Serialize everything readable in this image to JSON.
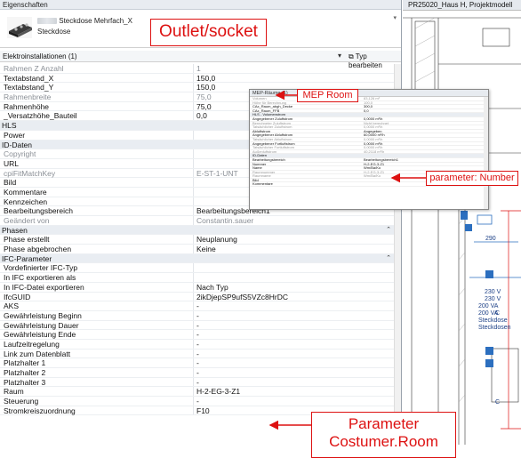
{
  "palette_title": "Eigenschaften",
  "type_selector": {
    "family": "Steckdose Mehrfach_X",
    "type": "Steckdose"
  },
  "filter": {
    "label": "Elektroinstallationen (1)",
    "edit_type": "Typ bearbeiten"
  },
  "rows": [
    {
      "k": "Rahmen Z Anzahl",
      "v": "1",
      "dim": true
    },
    {
      "k": "Textabstand_X",
      "v": "150,0"
    },
    {
      "k": "Textabstand_Y",
      "v": "150,0"
    },
    {
      "k": "Rahmenbreite",
      "v": "75,0",
      "dim": true
    },
    {
      "k": "Rahmenhöhe",
      "v": "75,0"
    },
    {
      "k": "_Versatzhöhe_Bauteil",
      "v": "0,0"
    },
    {
      "k": "HLS",
      "group": true
    },
    {
      "k": "Power",
      "v": ""
    },
    {
      "k": "ID-Daten",
      "group": true
    },
    {
      "k": "Copyright",
      "v": "",
      "dim": true
    },
    {
      "k": "URL",
      "v": ""
    },
    {
      "k": "cpiFitMatchKey",
      "v": "E-ST-1-UNT",
      "dim": true
    },
    {
      "k": "Bild",
      "v": ""
    },
    {
      "k": "Kommentare",
      "v": ""
    },
    {
      "k": "Kennzeichen",
      "v": ""
    },
    {
      "k": "Bearbeitungsbereich",
      "v": "Bearbeitungsbereich1"
    },
    {
      "k": "Geändert von",
      "v": "Constantin.sauer",
      "dim": true
    },
    {
      "k": "Phasen",
      "group": true,
      "chev": "⌃"
    },
    {
      "k": "Phase erstellt",
      "v": "Neuplanung"
    },
    {
      "k": "Phase abgebrochen",
      "v": "Keine"
    },
    {
      "k": "IFC-Parameter",
      "group": true,
      "chev": "⌃"
    },
    {
      "k": "Vordefinierter IFC-Typ",
      "v": ""
    },
    {
      "k": "In IFC exportieren als",
      "v": ""
    },
    {
      "k": "In IFC-Datei exportieren",
      "v": "Nach Typ"
    },
    {
      "k": "IfcGUID",
      "v": "2ikDjepSP9ufS5VZc8HrDC"
    },
    {
      "k": "AKS",
      "v": "-"
    },
    {
      "k": "Gewährleistung Beginn",
      "v": "-"
    },
    {
      "k": "Gewährleistung Dauer",
      "v": "-"
    },
    {
      "k": "Gewährleistung Ende",
      "v": "-"
    },
    {
      "k": "Laufzeitregelung",
      "v": "-"
    },
    {
      "k": "Link zum Datenblatt",
      "v": "-"
    },
    {
      "k": "Platzhalter 1",
      "v": "-"
    },
    {
      "k": "Platzhalter 2",
      "v": "-"
    },
    {
      "k": "Platzhalter 3",
      "v": "-"
    },
    {
      "k": "Raum",
      "v": "H-2-EG-3-Z1"
    },
    {
      "k": "Steuerung",
      "v": "-"
    },
    {
      "k": "Stromkreiszuordnung",
      "v": "F10"
    }
  ],
  "view": {
    "tab": "PR25020_Haus H, Projektmodell"
  },
  "mep": {
    "title": "MEP-Räume (1)",
    "rows": [
      {
        "k": "Volumen",
        "v": "83,126 m³",
        "dim": true
      },
      {
        "k": "Höhe für Berechnung",
        "v": "100,0",
        "dim": true
      },
      {
        "k": "CAx_Raum_abgh_Decke",
        "v": "300,0"
      },
      {
        "k": "CAx_Raum_FFB",
        "v": "0,0"
      },
      {
        "k": "HLS - Volumenstrom",
        "v": "",
        "g": true
      },
      {
        "k": "Angegebener Zuluftstrom",
        "v": "0,0000 m³/h"
      },
      {
        "k": "Berechneter Zuluftstrom",
        "v": "Nicht berechnet",
        "dim": true
      },
      {
        "k": "Tatsächlicher Zuluftstrom",
        "v": "0,0000 m³/h",
        "dim": true
      },
      {
        "k": "Abluftstrom",
        "v": "Angegeben"
      },
      {
        "k": "Angegebener Abluftstrom",
        "v": "60,0000 m³/h"
      },
      {
        "k": "Tatsächlicher Abluftstrom",
        "v": "0,0000 m³/h",
        "dim": true
      },
      {
        "k": "Angegebener Fortluftstrom",
        "v": "0,0000 m³/h"
      },
      {
        "k": "Tatsächlicher Fortluftstrom",
        "v": "0,0000 m³/h",
        "dim": true
      },
      {
        "k": "Außenluftstrom",
        "v": "40,2118 m³/h",
        "dim": true
      },
      {
        "k": "ID-Daten",
        "v": "",
        "g": true
      },
      {
        "k": "Bearbeitungsbereich",
        "v": "Bearbeitungsbereich1"
      },
      {
        "k": "Nummer",
        "v": "H-2-EG-3-Z1"
      },
      {
        "k": "Name",
        "v": "Wm/Ba/Ko"
      },
      {
        "k": "Raumnummer",
        "v": "H-2-EG-3-Z1",
        "dim": true
      },
      {
        "k": "Raumname",
        "v": "Wm/Ba/Ko",
        "dim": true
      },
      {
        "k": "Bild",
        "v": ""
      },
      {
        "k": "Kommentare",
        "v": ""
      }
    ]
  },
  "annotations": {
    "outlet": "Outlet/socket",
    "mep": "MEP Room",
    "param_number": "parameter: Number",
    "param_room_1": "Parameter",
    "param_room_2": "Costumer.Room"
  },
  "drawing_labels": {
    "n290": "290",
    "n230a": "230 V",
    "n230b": "230 V",
    "n200a": "200 VA",
    "n200b": "200 VA",
    "steck1": "Steckdose",
    "steck2": "Steckdosen",
    "c1": "C",
    "c2": "C"
  },
  "colors": {
    "annotation": "#dd1111",
    "blue_symbol": "#2c6fbf"
  }
}
